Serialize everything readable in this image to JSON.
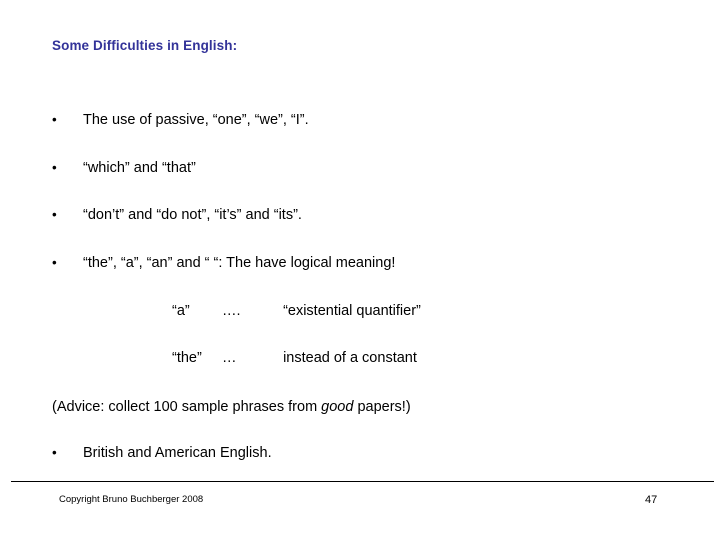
{
  "slide": {
    "title": "Some Difficulties in English:",
    "title_color": "#333399",
    "background_color": "#ffffff",
    "text_color": "#000000",
    "bullet_marker": "•",
    "bullets": [
      {
        "marker": "•",
        "text": "The use of passive, “one”, “we”, “I”."
      },
      {
        "marker": "•",
        "text": "“which” and “that”"
      },
      {
        "marker": "•",
        "text": "“don’t” and “do not”,  “it’s” and “its”."
      },
      {
        "marker": "•",
        "text": "“the”, “a”, “an” and “  “: The have logical meaning!"
      },
      {
        "marker": "•",
        "text": "British and American English."
      }
    ],
    "definitions": [
      {
        "term": "“a”",
        "dots": "….",
        "meaning": "“existential quantifier”"
      },
      {
        "term": "“the”",
        "dots": "…",
        "meaning": "instead of a constant"
      }
    ],
    "advice": {
      "before": "(Advice: collect 100 sample phrases from ",
      "emphasis": "good",
      "after": " papers!)"
    },
    "footer": {
      "copyright": "Copyright Bruno Buchberger 2008",
      "page_number": "47"
    }
  }
}
